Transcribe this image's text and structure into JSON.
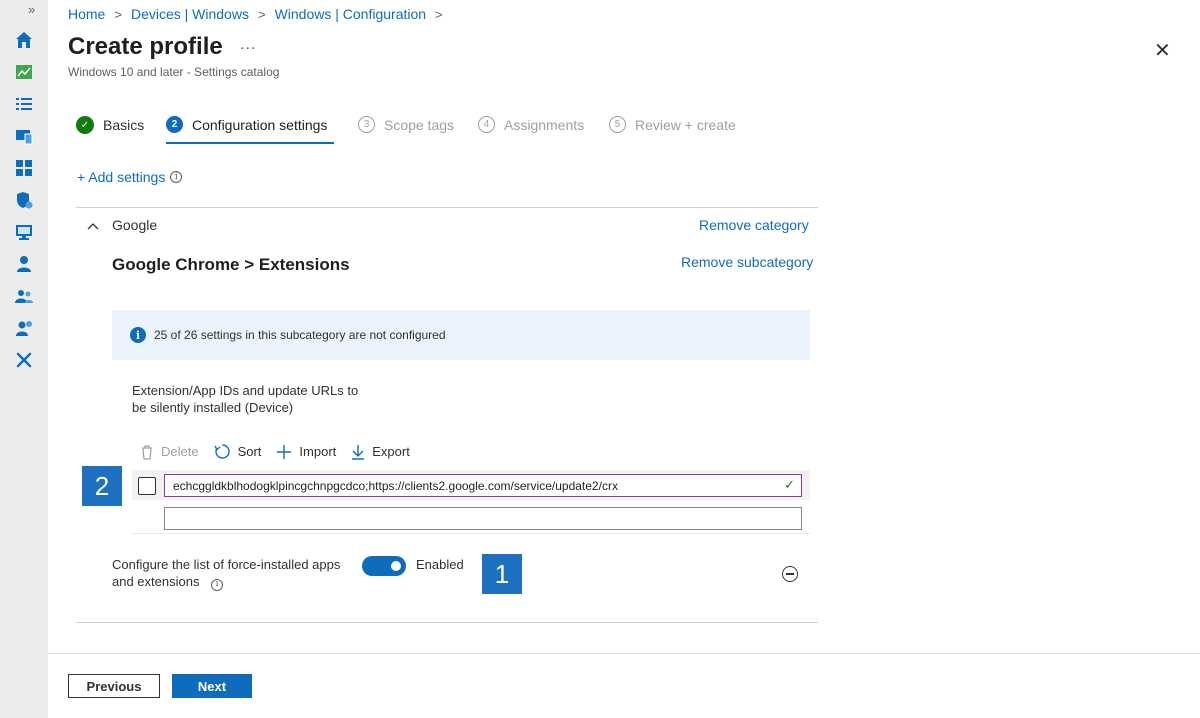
{
  "rail": {
    "expand": "»",
    "icons": [
      "home-icon",
      "dashboard-icon",
      "all-services-icon",
      "devices-icon",
      "apps-icon",
      "endpoint-security-icon",
      "reports-icon",
      "users-icon",
      "groups-icon",
      "tenant-admin-icon",
      "troubleshooting-icon"
    ]
  },
  "breadcrumb": [
    "Home",
    "Devices | Windows",
    "Windows | Configuration"
  ],
  "header": {
    "title": "Create profile",
    "more": "...",
    "subtitle": "Windows 10 and later - Settings catalog",
    "close": "✕"
  },
  "steps": [
    {
      "num": "✓",
      "label": "Basics",
      "state": "done"
    },
    {
      "num": "2",
      "label": "Configuration settings",
      "state": "active"
    },
    {
      "num": "3",
      "label": "Scope tags",
      "state": "inactive"
    },
    {
      "num": "4",
      "label": "Assignments",
      "state": "inactive"
    },
    {
      "num": "5",
      "label": "Review + create",
      "state": "inactive"
    }
  ],
  "add_settings": "+ Add settings",
  "category": {
    "name": "Google",
    "remove": "Remove category",
    "subcategory": "Google Chrome > Extensions",
    "remove_sub": "Remove subcategory"
  },
  "info": {
    "icon": "i",
    "text": "25 of 26 settings in this subcategory are not configured"
  },
  "setting": {
    "label_line1": "Extension/App IDs and update URLs to",
    "label_line2": "be silently installed (Device)",
    "toolbar": {
      "delete": "Delete",
      "sort": "Sort",
      "import": "Import",
      "export": "Export"
    },
    "value": "echcggldkblhodogklpincgchnpgcdco;https://clients2.google.com/service/update2/crx",
    "valid_mark": "✓"
  },
  "config": {
    "label_line1": "Configure the list of force-installed apps",
    "label_line2": "and extensions",
    "info_icon": "i",
    "toggle_state": "Enabled"
  },
  "badges": {
    "first": "1",
    "second": "2"
  },
  "footer": {
    "previous": "Previous",
    "next": "Next"
  },
  "colors": {
    "accent": "#0f6cbd",
    "success": "#107c10",
    "badge": "#1e70c1"
  }
}
